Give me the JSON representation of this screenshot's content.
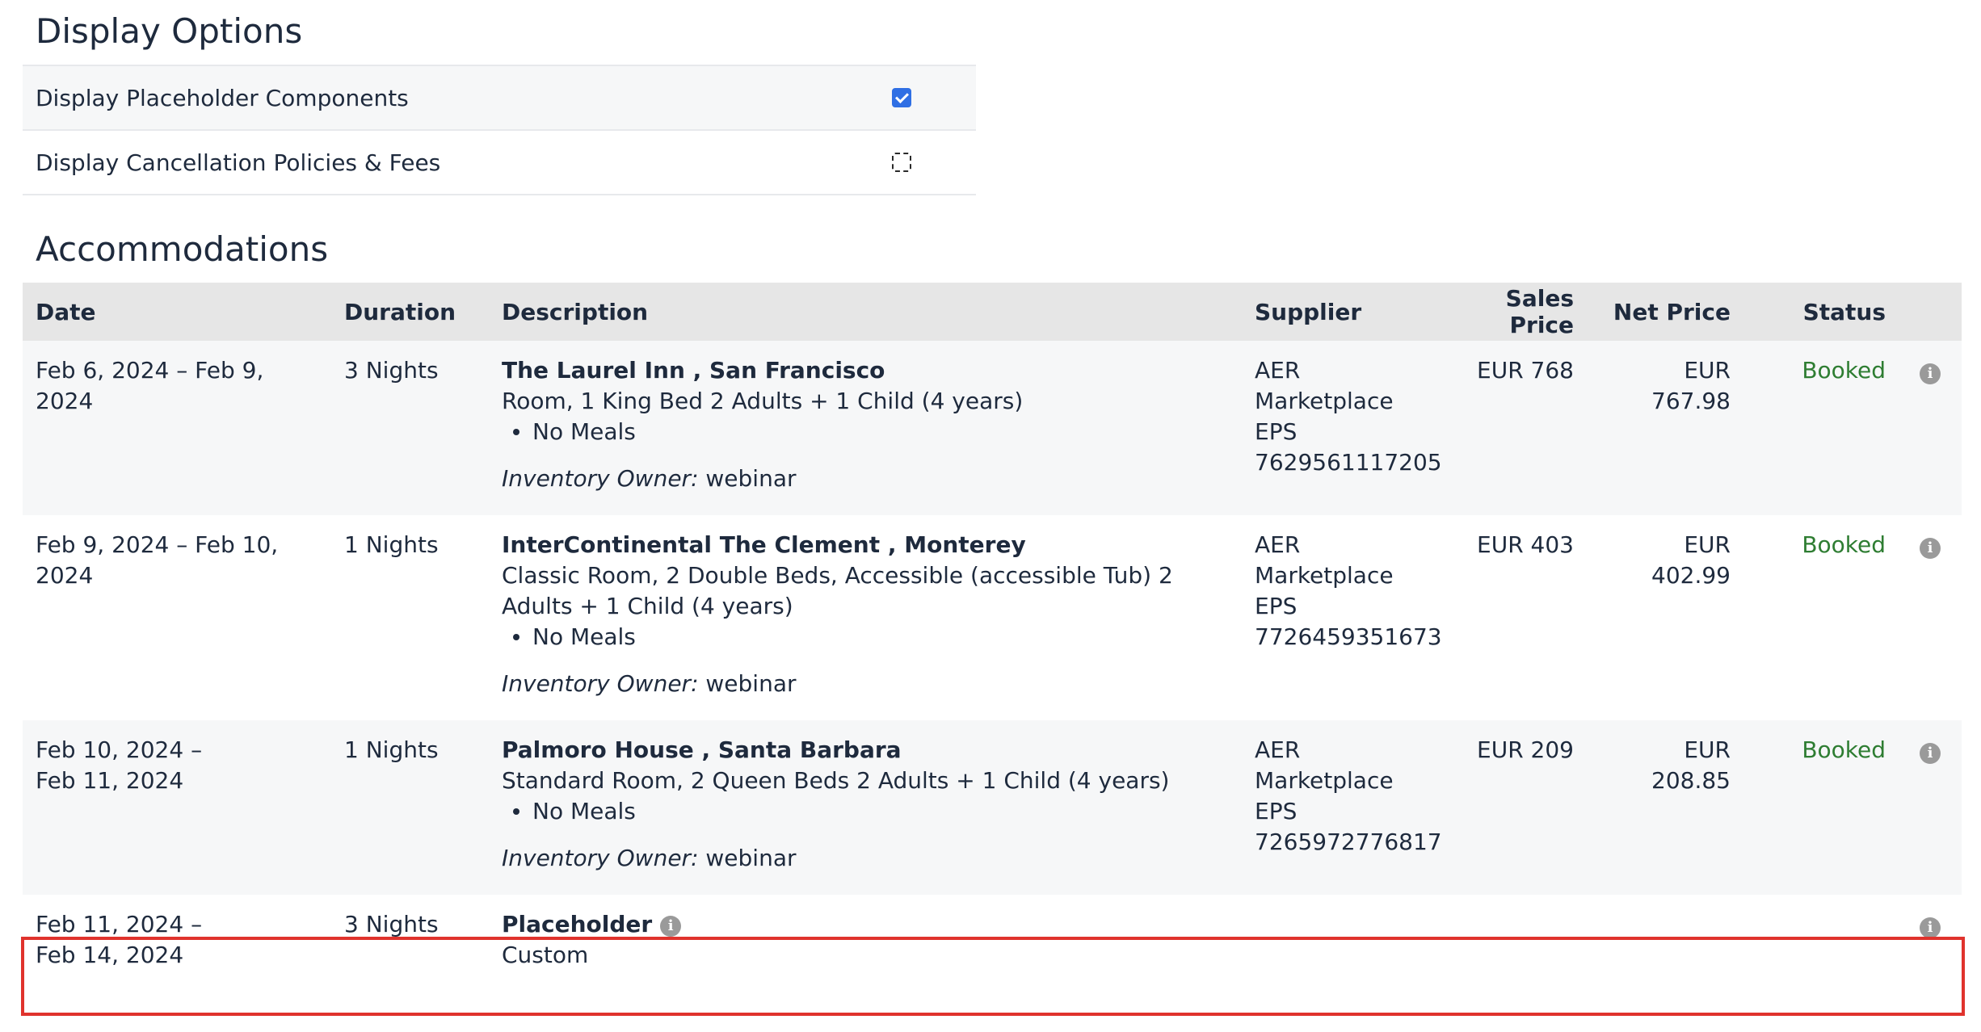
{
  "display_options": {
    "title": "Display Options",
    "items": [
      {
        "label": "Display Placeholder Components",
        "checked": true
      },
      {
        "label": "Display Cancellation Policies & Fees",
        "checked": false
      }
    ]
  },
  "accommodations": {
    "title": "Accommodations",
    "columns": [
      "Date",
      "Duration",
      "Description",
      "Supplier",
      "Sales Price",
      "Net Price",
      "Status"
    ],
    "rows": [
      {
        "date": "Feb 6, 2024 – Feb 9, 2024",
        "duration": "3 Nights",
        "hotel": "The Laurel Inn , San Francisco",
        "room": "Room, 1 King Bed 2 Adults + 1 Child (4 years)",
        "meals": "No Meals",
        "owner_label": "Inventory Owner:",
        "owner": "webinar",
        "supplier": [
          "AER",
          "Marketplace",
          "EPS",
          "7629561117205"
        ],
        "sales_price": "EUR 768",
        "net_price": "EUR 767.98",
        "status": "Booked"
      },
      {
        "date": "Feb 9, 2024 – Feb 10, 2024",
        "duration": "1 Nights",
        "hotel": "InterContinental The Clement , Monterey",
        "room": "Classic Room, 2 Double Beds, Accessible (accessible Tub) 2 Adults + 1 Child (4 years)",
        "meals": "No Meals",
        "owner_label": "Inventory Owner:",
        "owner": "webinar",
        "supplier": [
          "AER",
          "Marketplace",
          "EPS",
          "7726459351673"
        ],
        "sales_price": "EUR 403",
        "net_price": "EUR 402.99",
        "status": "Booked"
      },
      {
        "date_line1": "Feb 10, 2024 –",
        "date_line2": "Feb 11, 2024",
        "duration": "1 Nights",
        "hotel": "Palmoro House , Santa Barbara",
        "room": "Standard Room, 2 Queen Beds 2 Adults + 1 Child (4 years)",
        "meals": "No Meals",
        "owner_label": "Inventory Owner:",
        "owner": "webinar",
        "supplier": [
          "AER",
          "Marketplace",
          "EPS",
          "7265972776817"
        ],
        "sales_price": "EUR 209",
        "net_price": "EUR 208.85",
        "status": "Booked"
      },
      {
        "date_line1": "Feb 11, 2024 –",
        "date_line2": "Feb 14, 2024",
        "duration": "3 Nights",
        "hotel": "Placeholder",
        "room": "Custom"
      }
    ]
  },
  "colors": {
    "status_booked": "#2e7d32",
    "highlight": "#e0332d",
    "checkbox": "#2f6fe4"
  },
  "icons": {
    "info": "info-circle-icon",
    "checkbox": "checkmark-icon"
  }
}
